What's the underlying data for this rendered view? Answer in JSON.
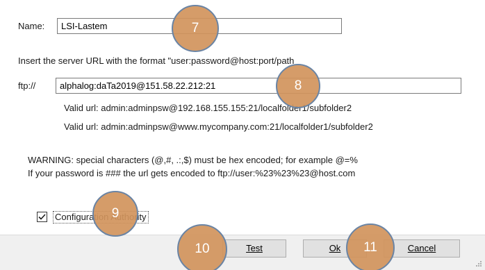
{
  "name_label": "Name:",
  "name_value": "LSI-Lastem",
  "instruction": "Insert the server URL with the format \"user:password@host:port/path",
  "protocol_label": "ftp://",
  "url_value": "alphalog:daTa2019@151.58.22.212:21",
  "example_1": "Valid url: admin:adminpsw@192.168.155.155:21/localfolder1/subfolder2",
  "example_2": "Valid url: admin:adminpsw@www.mycompany.com:21/localfolder1/subfolder2",
  "warning_1": "WARNING: special characters (@,#, .:,$) must be hex encoded; for example @=%",
  "warning_2": "If your password is ### the url gets encoded to ftp://user:%23%23%23@host.com",
  "checkbox": {
    "label": "Configuration Authority",
    "checked": true
  },
  "buttons": {
    "test": "Test",
    "ok": "Ok",
    "cancel": "Cancel"
  },
  "markers": {
    "m7": "7",
    "m8": "8",
    "m9": "9",
    "m10": "10",
    "m11": "11"
  },
  "colors": {
    "marker_fill": "#d1945c",
    "marker_border": "#6a84a4"
  }
}
